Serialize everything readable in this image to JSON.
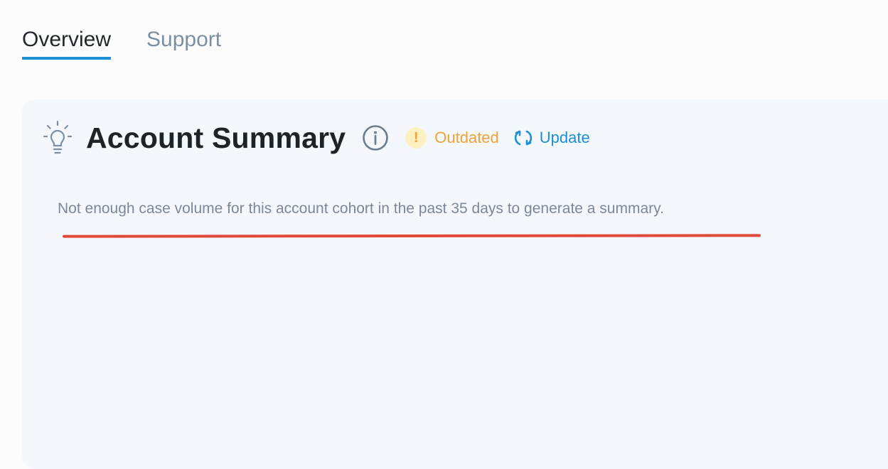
{
  "tabs": [
    {
      "label": "Overview",
      "active": true
    },
    {
      "label": "Support",
      "active": false
    }
  ],
  "card": {
    "title": "Account Summary",
    "icons": {
      "header": "lightbulb-icon",
      "info": "info-icon",
      "status": "exclamation-icon",
      "update": "refresh-icon"
    },
    "status_label": "Outdated",
    "status_symbol": "!",
    "update_label": "Update",
    "message": "Not enough case volume for this account cohort in the past 35 days to generate a summary."
  },
  "colors": {
    "accent": "#1f8fd6",
    "warning": "#f0a236",
    "annotation": "#e0483a",
    "card_background": "#f4f8fc"
  }
}
